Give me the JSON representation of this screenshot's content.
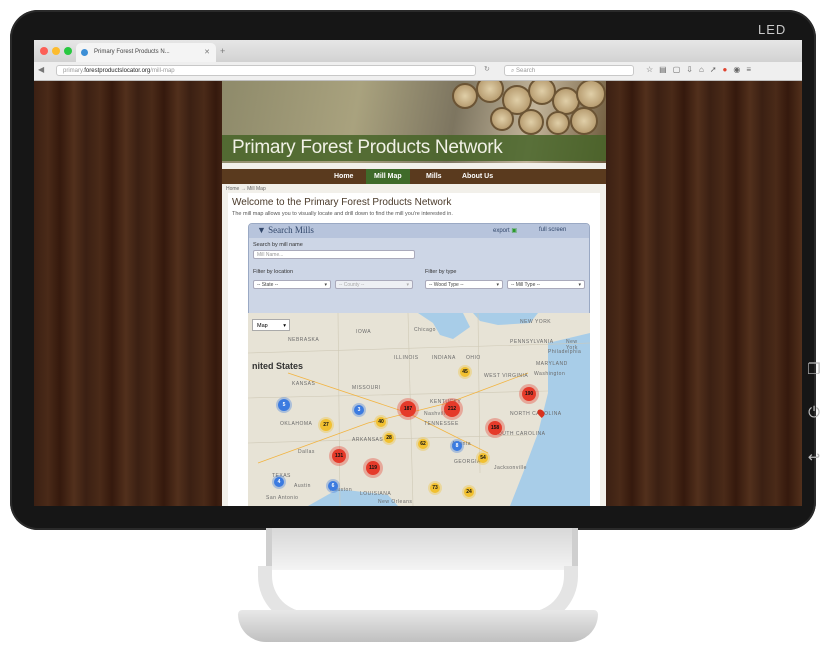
{
  "monitor": {
    "brand_label": "LED"
  },
  "browser": {
    "tab_title": "Primary Forest Products N...",
    "url_prefix": "primary.",
    "url_domain": "forestproductslocator.org",
    "url_path": "/mill-map",
    "search_placeholder": "Search"
  },
  "site": {
    "banner_title": "Primary Forest Products Network",
    "nav": [
      "Home",
      "Mill Map",
      "Mills",
      "About Us"
    ],
    "active_nav": "Mill Map",
    "breadcrumb": "Home → Mill Map",
    "welcome_heading": "Welcome to the Primary Forest Products Network",
    "welcome_text": "The mill map allows you to visually locate and drill down to find the mill you're interested in."
  },
  "search_panel": {
    "title": "Search Mills",
    "export_label": "export",
    "fullscreen_label": "full screen",
    "search_by_name_label": "Search by mill name",
    "mill_name_placeholder": "Mill Name...",
    "filter_location_label": "Filter by location",
    "filter_type_label": "Filter by type",
    "state_select": "-- State --",
    "county_select": "-- County --",
    "wood_type_select": "-- Wood Type --",
    "mill_type_select": "-- Mill Type --"
  },
  "map": {
    "view_select": "Map",
    "country_label": "nited States",
    "place_labels": [
      "NEBRASKA",
      "IOWA",
      "Chicago",
      "ILLINOIS",
      "INDIANA",
      "OHIO",
      "KANSAS",
      "MISSOURI",
      "OKLAHOMA",
      "ARKANSAS",
      "KENTUCKY",
      "Nashville",
      "TENNESSEE",
      "Dallas",
      "TEXAS",
      "LOUISIANA",
      "Atlanta",
      "GEORGIA",
      "PENNSYLVANIA",
      "New York",
      "Philadelphia",
      "MARYLAND",
      "Washington",
      "WEST VIRGINIA",
      "NORTH CAROLINA",
      "SOUTH CAROLINA",
      "Jacksonville",
      "NEW YORK",
      "Austin",
      "San Antonio",
      "Houston",
      "New Orleans"
    ],
    "clusters": [
      {
        "color": "blue",
        "count": "5"
      },
      {
        "color": "blue",
        "count": "3"
      },
      {
        "color": "yellow",
        "count": "27"
      },
      {
        "color": "red",
        "count": "187"
      },
      {
        "color": "red",
        "count": "212"
      },
      {
        "color": "red",
        "count": "158"
      },
      {
        "color": "red",
        "count": "190"
      },
      {
        "color": "yellow",
        "count": "45"
      },
      {
        "color": "yellow",
        "count": "28"
      },
      {
        "color": "yellow",
        "count": "62"
      },
      {
        "color": "blue",
        "count": "8"
      },
      {
        "color": "red",
        "count": "131"
      },
      {
        "color": "red",
        "count": "119"
      },
      {
        "color": "yellow",
        "count": "54"
      },
      {
        "color": "blue",
        "count": "4"
      },
      {
        "color": "blue",
        "count": "6"
      },
      {
        "color": "yellow",
        "count": "73"
      },
      {
        "color": "yellow",
        "count": "24"
      },
      {
        "color": "yellow",
        "count": "40"
      }
    ]
  }
}
